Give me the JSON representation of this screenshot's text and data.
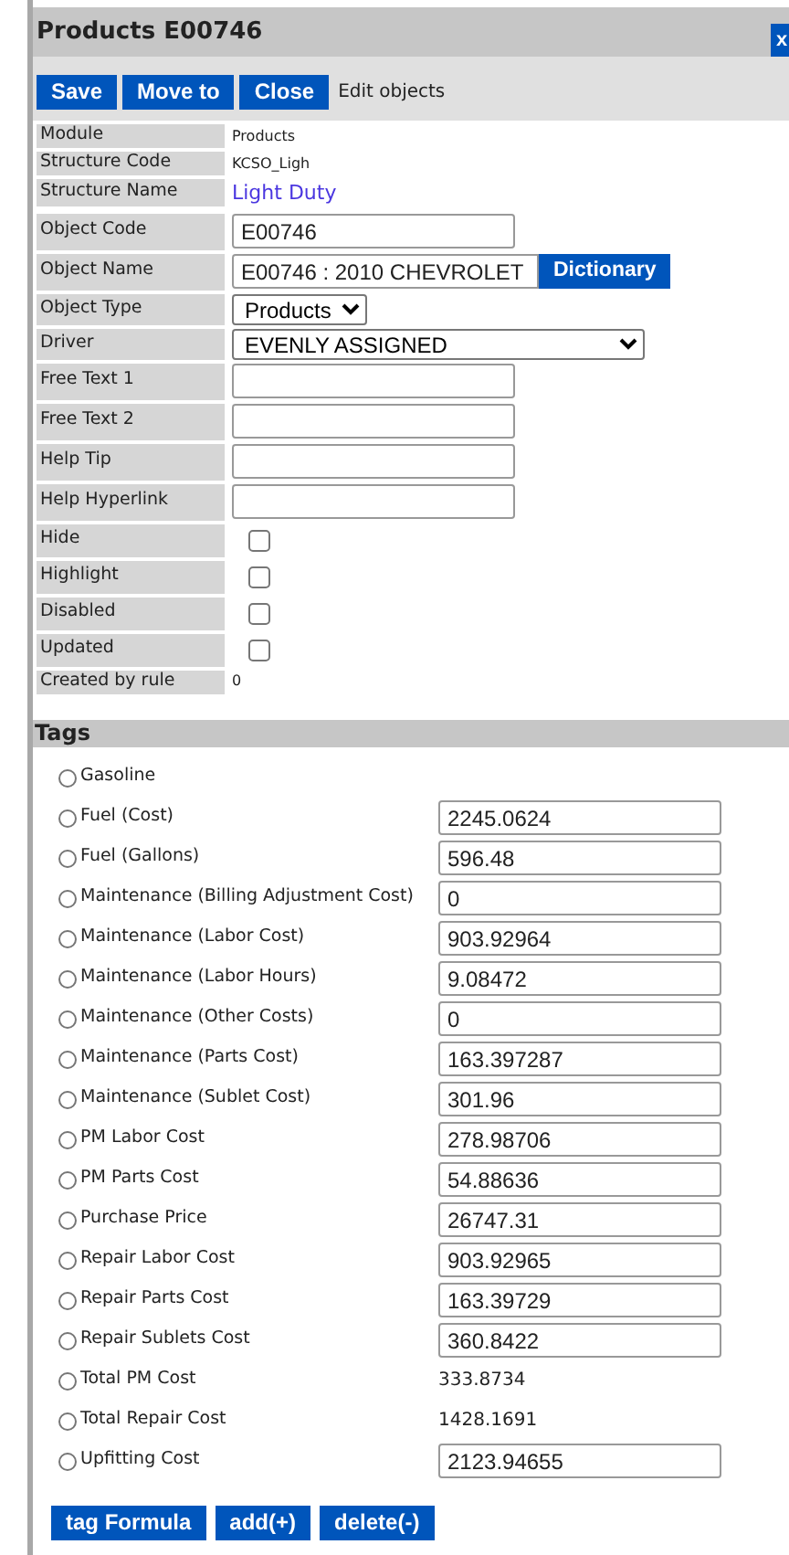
{
  "window": {
    "title": "Products E00746",
    "close": "x"
  },
  "toolbar": {
    "buttons": [
      "Save",
      "Move to",
      "Close"
    ],
    "caption": "Edit objects"
  },
  "fields": [
    {
      "label": "Module",
      "kind": "small",
      "value": "Products"
    },
    {
      "label": "Structure Code",
      "kind": "small",
      "value": "KCSO_Ligh"
    },
    {
      "label": "Structure Name",
      "kind": "link",
      "value": "Light Duty"
    },
    {
      "label": "Object Code",
      "kind": "input",
      "value": "E00746"
    },
    {
      "label": "Object Name",
      "kind": "input-button",
      "value": "E00746 : 2010 CHEVROLET",
      "button": "Dictionary"
    },
    {
      "label": "Object Type",
      "kind": "select",
      "value": "Products"
    },
    {
      "label": "Driver",
      "kind": "select-wide",
      "value": "EVENLY ASSIGNED"
    },
    {
      "label": "Free Text 1",
      "kind": "input"
    },
    {
      "label": "Free Text 2",
      "kind": "input"
    },
    {
      "label": "Help Tip",
      "kind": "input"
    },
    {
      "label": "Help Hyperlink",
      "kind": "input"
    },
    {
      "label": "Hide",
      "kind": "checkbox",
      "checked": false
    },
    {
      "label": "Highlight",
      "kind": "checkbox",
      "checked": false
    },
    {
      "label": "Disabled",
      "kind": "checkbox",
      "checked": false
    },
    {
      "label": "Updated",
      "kind": "checkbox",
      "checked": false
    },
    {
      "label": "Created by rule",
      "kind": "small",
      "value": "0"
    }
  ],
  "tags": {
    "title": "Tags",
    "items": [
      {
        "label": "Gasoline",
        "kind": "none",
        "selected": false
      },
      {
        "label": "Fuel (Cost)",
        "kind": "input",
        "value": "2245.0624",
        "selected": false
      },
      {
        "label": "Fuel (Gallons)",
        "kind": "input",
        "value": "596.48",
        "selected": false
      },
      {
        "label": "Maintenance (Billing Adjustment Cost)",
        "kind": "input",
        "value": "0",
        "selected": false
      },
      {
        "label": "Maintenance (Labor Cost)",
        "kind": "input",
        "value": "903.92964",
        "selected": false
      },
      {
        "label": "Maintenance (Labor Hours)",
        "kind": "input",
        "value": "9.08472",
        "selected": false
      },
      {
        "label": "Maintenance (Other Costs)",
        "kind": "input",
        "value": "0",
        "selected": false
      },
      {
        "label": "Maintenance (Parts Cost)",
        "kind": "input",
        "value": "163.397287",
        "selected": false
      },
      {
        "label": "Maintenance (Sublet Cost)",
        "kind": "input",
        "value": "301.96",
        "selected": false
      },
      {
        "label": "PM Labor Cost",
        "kind": "input",
        "value": "278.98706",
        "selected": false
      },
      {
        "label": "PM Parts Cost",
        "kind": "input",
        "value": "54.88636",
        "selected": false
      },
      {
        "label": "Purchase Price",
        "kind": "input",
        "value": "26747.31",
        "selected": false
      },
      {
        "label": "Repair Labor Cost",
        "kind": "input",
        "value": "903.92965",
        "selected": false
      },
      {
        "label": "Repair Parts Cost",
        "kind": "input",
        "value": "163.39729",
        "selected": false
      },
      {
        "label": "Repair Sublets Cost",
        "kind": "input",
        "value": "360.8422",
        "selected": false
      },
      {
        "label": "Total PM Cost",
        "kind": "text",
        "value": "333.8734",
        "selected": false
      },
      {
        "label": "Total Repair Cost",
        "kind": "text",
        "value": "1428.1691",
        "selected": false
      },
      {
        "label": "Upfitting Cost",
        "kind": "input",
        "value": "2123.94655",
        "selected": false
      }
    ],
    "buttons": [
      "tag Formula",
      "add(+)",
      "delete(-)"
    ]
  }
}
